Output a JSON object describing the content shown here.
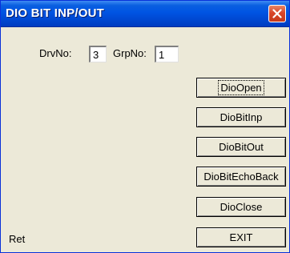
{
  "window": {
    "title": "DIO BIT INP/OUT"
  },
  "form": {
    "drvno_label": "DrvNo:",
    "drvno_value": "3",
    "grpno_label": "GrpNo:",
    "grpno_value": "1"
  },
  "buttons": {
    "dio_open": "DioOpen",
    "dio_bit_inp": "DioBitInp",
    "dio_bit_out": "DioBitOut",
    "dio_bit_echo_back": "DioBitEchoBack",
    "dio_close": "DioClose",
    "exit": "EXIT"
  },
  "status": {
    "ret_label": "Ret"
  }
}
